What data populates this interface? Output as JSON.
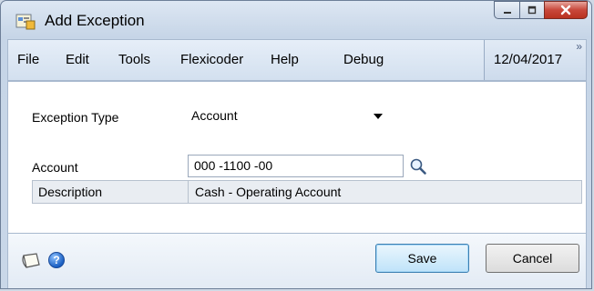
{
  "window": {
    "title": "Add Exception",
    "title_bar_buttons": {
      "minimize": "minimize-icon",
      "maximize": "maximize-icon",
      "close": "close-icon"
    }
  },
  "menu": {
    "items": [
      {
        "label": "File"
      },
      {
        "label": "Edit"
      },
      {
        "label": "Tools"
      },
      {
        "label": "Flexicoder"
      },
      {
        "label": "Help"
      },
      {
        "label": "Debug"
      }
    ],
    "date": "12/04/2017",
    "overflow_icon": "chevron-double-right-icon"
  },
  "form": {
    "exception_type": {
      "label": "Exception Type",
      "value": "Account"
    },
    "account": {
      "label": "Account",
      "value": "000 -1100 -00",
      "lookup_icon": "magnifier-icon"
    },
    "description": {
      "label": "Description",
      "value": "Cash - Operating Account"
    }
  },
  "footer": {
    "note_icon": "note-icon",
    "help_icon": "help-icon",
    "save_label": "Save",
    "cancel_label": "Cancel"
  },
  "colors": {
    "window_frame": "#c6d5e7",
    "close_button": "#c8473a",
    "default_button_border": "#3c7fb1"
  }
}
